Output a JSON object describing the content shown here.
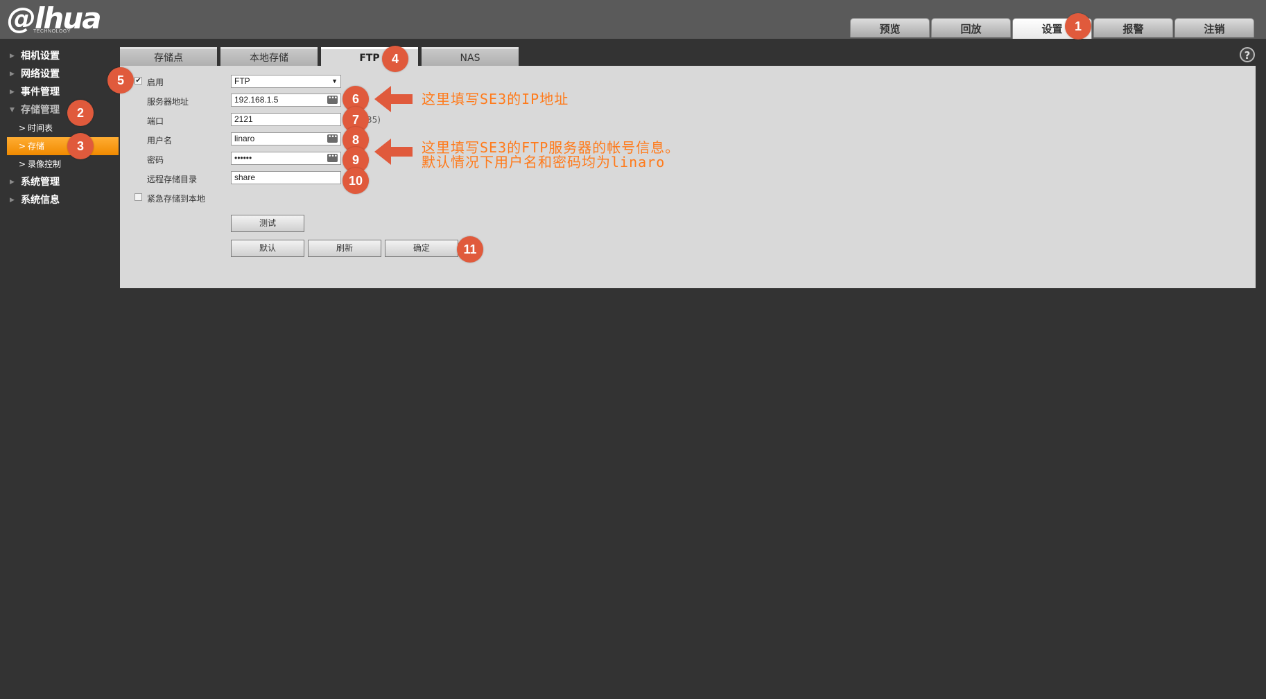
{
  "header": {
    "logo_text": "@lhua",
    "logo_sub": "TECHNOLOGY",
    "nav": [
      "预览",
      "回放",
      "设置",
      "报警",
      "注销"
    ],
    "active_nav": "设置"
  },
  "sidebar": {
    "items": [
      {
        "label": "相机设置"
      },
      {
        "label": "网络设置"
      },
      {
        "label": "事件管理"
      },
      {
        "label": "存储管理"
      },
      {
        "label": "系统管理"
      },
      {
        "label": "系统信息"
      }
    ],
    "sub_items": [
      {
        "label": "时间表"
      },
      {
        "label": "存储"
      },
      {
        "label": "录像控制"
      }
    ]
  },
  "tabs": [
    "存储点",
    "本地存储",
    "FTP",
    "NAS"
  ],
  "help_icon": "?",
  "form": {
    "enable_label": "启用",
    "enable_checked": true,
    "protocol_value": "FTP",
    "server_label": "服务器地址",
    "server_value": "192.168.1.5",
    "port_label": "端口",
    "port_value": "2121",
    "port_hint": "35)",
    "user_label": "用户名",
    "user_value": "linaro",
    "password_label": "密码",
    "password_value": "••••••",
    "remote_dir_label": "远程存储目录",
    "remote_dir_value": "share",
    "emergency_label": "紧急存储到本地",
    "emergency_checked": false,
    "test_button": "测试",
    "default_button": "默认",
    "refresh_button": "刷新",
    "ok_button": "确定"
  },
  "annotations": {
    "badges": [
      "1",
      "2",
      "3",
      "4",
      "5",
      "6",
      "7",
      "8",
      "9",
      "10",
      "11"
    ],
    "note_ip": "这里填写SE3的IP地址",
    "note_account_line1": "这里填写SE3的FTP服务器的帐号信息。",
    "note_account_line2": "默认情况下用户名和密码均为linaro",
    "color": "#e05a3c",
    "text_color": "#ff7a1a"
  }
}
